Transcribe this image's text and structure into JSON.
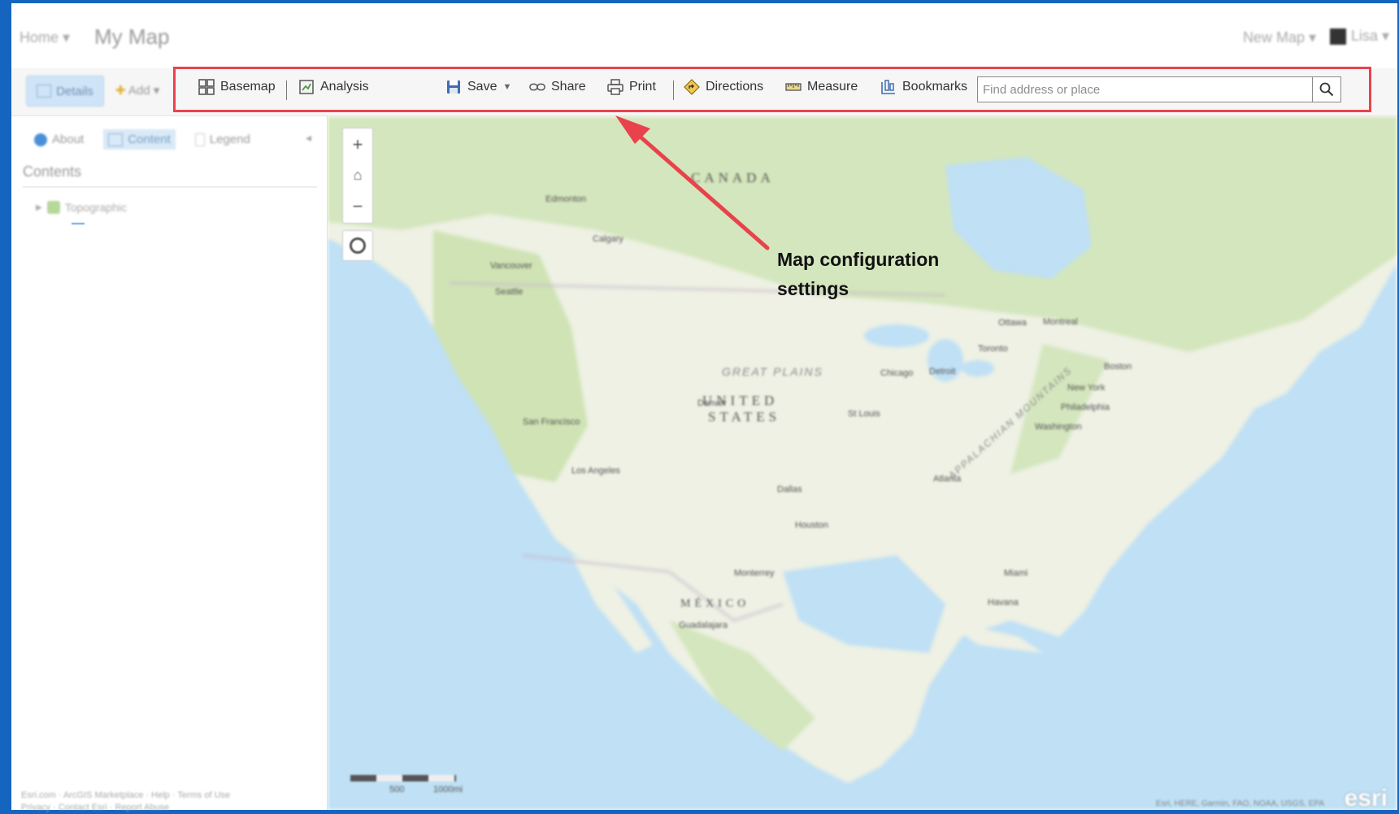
{
  "topnav": {
    "home": "Home ▾",
    "title": "My Map",
    "new_map": "New Map ▾",
    "user": "Lisa ▾"
  },
  "toolbar": {
    "details": "Details",
    "add": "Add ▾",
    "basemap": "Basemap",
    "analysis": "Analysis",
    "save": "Save",
    "share": "Share",
    "print": "Print",
    "directions": "Directions",
    "measure": "Measure",
    "bookmarks": "Bookmarks",
    "search_placeholder": "Find address or place"
  },
  "sidebar": {
    "tabs": [
      "About",
      "Content",
      "Legend"
    ],
    "contents_heading": "Contents",
    "layer": "Topographic",
    "footer_line1": "Esri.com · ArcGIS Marketplace · Help · Terms of Use",
    "footer_line2": "Privacy · Contact Esri · Report Abuse"
  },
  "map": {
    "labels": {
      "canada": "CANADA",
      "us1": "UNITED",
      "us2": "STATES",
      "mexico": "MÉXICO",
      "great_plains": "GREAT PLAINS",
      "appalachian": "APPALACHIAN MOUNTAINS"
    },
    "cities": [
      "Edmonton",
      "Calgary",
      "Vancouver",
      "Seattle",
      "Denver",
      "San Francisco",
      "Los Angeles",
      "Dallas",
      "Houston",
      "Chicago",
      "Detroit",
      "Toronto",
      "Montreal",
      "Ottawa",
      "Boston",
      "New York",
      "Philadelphia",
      "Washington",
      "Atlanta",
      "St Louis",
      "Monterrey",
      "Guadalajara",
      "Havana",
      "Miami"
    ],
    "scale_labels": [
      "500",
      "1000mi"
    ],
    "attribution": "Esri, HERE, Garmin, FAO, NOAA, USGS, EPA",
    "logo": "esri"
  },
  "annotation": {
    "line1": "Map configuration",
    "line2": "settings"
  },
  "colors": {
    "highlight": "#e8434c",
    "arrow": "#e8434c",
    "water": "#bfe0f5",
    "land": "#eef1e4",
    "forest": "#d4e6bd"
  }
}
